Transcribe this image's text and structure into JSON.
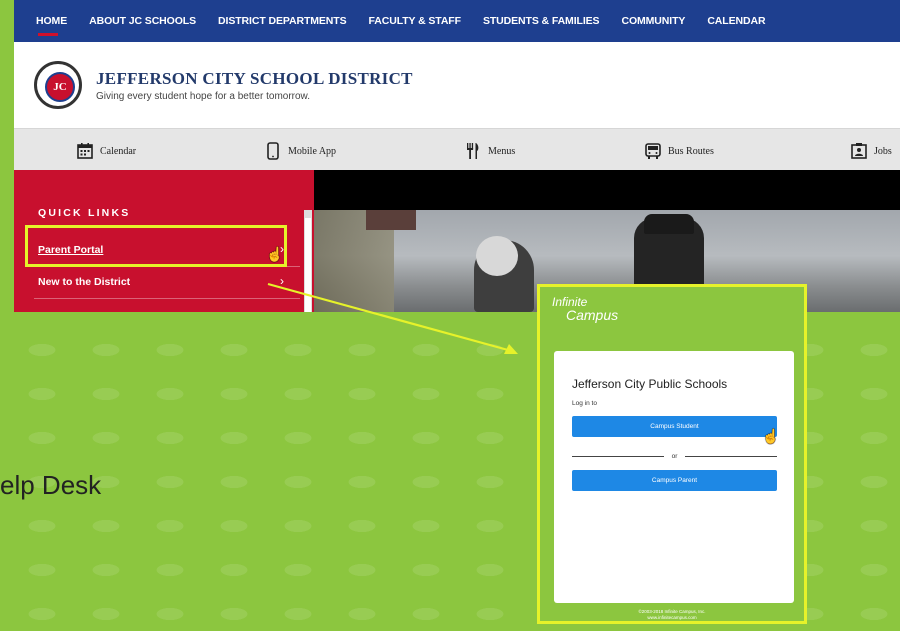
{
  "nav": {
    "items": [
      "HOME",
      "ABOUT JC SCHOOLS",
      "DISTRICT DEPARTMENTS",
      "FACULTY & STAFF",
      "STUDENTS & FAMILIES",
      "COMMUNITY",
      "CALENDAR"
    ],
    "active": "HOME"
  },
  "header": {
    "seal_text": "JC",
    "title": "JEFFERSON CITY SCHOOL DISTRICT",
    "tagline": "Giving every student hope for a better tomorrow."
  },
  "quickbar": {
    "items": [
      {
        "label": "Calendar",
        "icon": "calendar-icon"
      },
      {
        "label": "Mobile App",
        "icon": "mobile-phone-icon"
      },
      {
        "label": "Menus",
        "icon": "fork-knife-icon"
      },
      {
        "label": "Bus Routes",
        "icon": "bus-icon"
      },
      {
        "label": "Jobs",
        "icon": "jobs-icon"
      }
    ]
  },
  "quick_links": {
    "title": "QUICK LINKS",
    "items": [
      "Parent Portal",
      "New to the District"
    ]
  },
  "infinite_campus": {
    "logo_line1": "Infinite",
    "logo_line2": "Campus",
    "school_name": "Jefferson City Public Schools",
    "login_label": "Log in to",
    "student_button": "Campus Student",
    "or_label": "or",
    "parent_button": "Campus Parent",
    "footer_line1": "©2003-2018 Infinite Campus, Inc.",
    "footer_line2": "www.infinitecampus.com"
  },
  "slide": {
    "partial_text": "elp Desk"
  },
  "colors": {
    "nav_bg": "#1e3f8f",
    "quick_links_bg": "#c8102e",
    "highlight": "#e6f22a",
    "slide_bg": "#8cc63f",
    "button_blue": "#1e88e5"
  }
}
